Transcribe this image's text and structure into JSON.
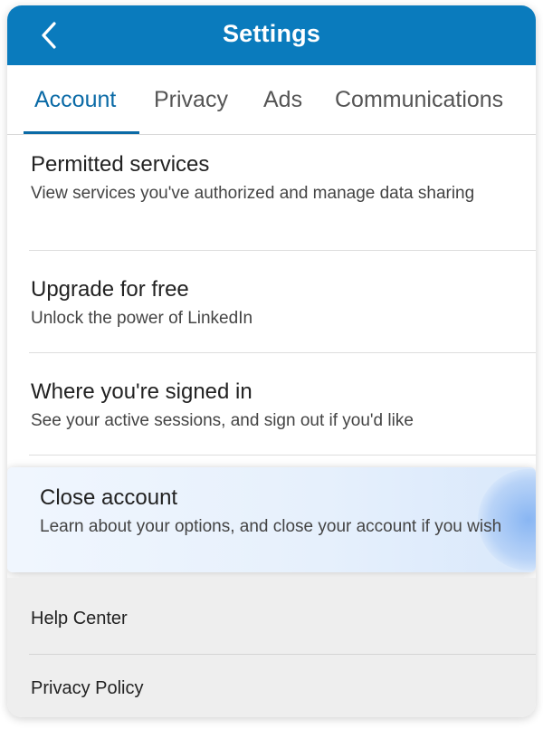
{
  "header": {
    "title": "Settings",
    "back_icon": "chevron-left-icon",
    "color": "#0a7bbd"
  },
  "tabs": [
    {
      "label": "Account",
      "active": true
    },
    {
      "label": "Privacy",
      "active": false
    },
    {
      "label": "Ads",
      "active": false
    },
    {
      "label": "Communications",
      "active": false
    }
  ],
  "settings_items": [
    {
      "title": "Permitted services",
      "subtitle": "View services you've authorized and manage data sharing"
    },
    {
      "title": "Upgrade for free",
      "subtitle": "Unlock the power of LinkedIn"
    },
    {
      "title": "Where you're signed in",
      "subtitle": "See your active sessions, and sign out if you'd like"
    },
    {
      "title": "Close account",
      "subtitle": "Learn about your options, and close your account if you wish",
      "highlighted": true
    }
  ],
  "links": [
    {
      "label": "Help Center"
    },
    {
      "label": "Privacy Policy"
    }
  ],
  "colors": {
    "accent": "#0a6aa6",
    "highlight": "#e6f0fc"
  }
}
